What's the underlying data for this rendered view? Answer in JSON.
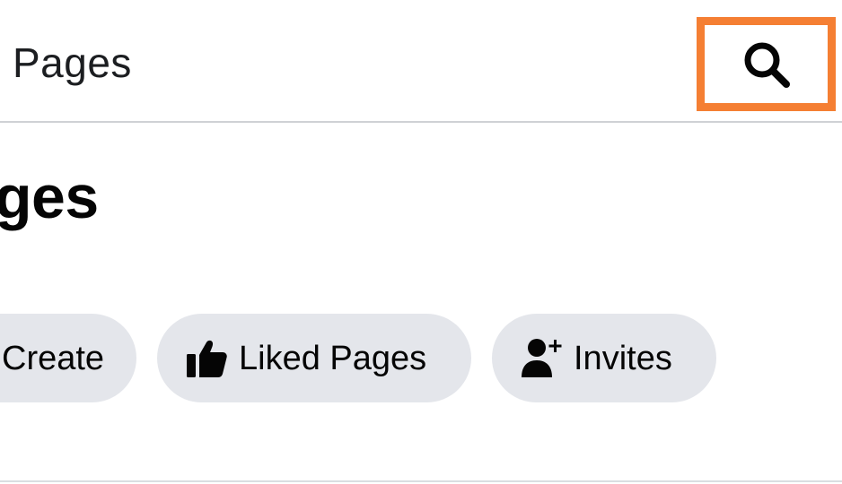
{
  "header": {
    "title": "Pages",
    "search_icon": "search-icon",
    "highlight_color": "#f57f33"
  },
  "main": {
    "heading": "ges"
  },
  "chips": {
    "create": {
      "label": "Create"
    },
    "liked_pages": {
      "label": "Liked Pages",
      "icon": "thumbs-up-icon"
    },
    "invites": {
      "label": "Invites",
      "icon": "add-person-icon"
    }
  },
  "colors": {
    "chip_background": "#e4e6eb",
    "text": "#050505",
    "divider": "#cfd1d5"
  }
}
